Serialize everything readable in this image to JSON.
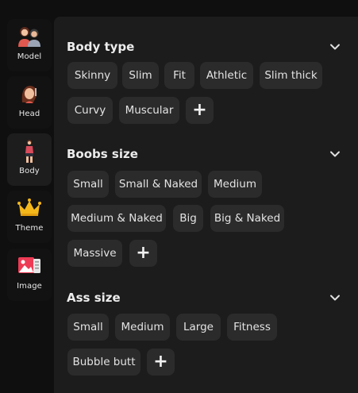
{
  "sidebar": {
    "items": [
      {
        "label": "Model",
        "icon": "model-icon"
      },
      {
        "label": "Head",
        "icon": "head-icon"
      },
      {
        "label": "Body",
        "icon": "body-icon"
      },
      {
        "label": "Theme",
        "icon": "crown-icon"
      },
      {
        "label": "Image",
        "icon": "image-icon"
      }
    ],
    "active": "Body"
  },
  "sections": [
    {
      "title": "Body type",
      "options": [
        "Skinny",
        "Slim",
        "Fit",
        "Athletic",
        "Slim thick",
        "Curvy",
        "Muscular"
      ],
      "add_label": "+"
    },
    {
      "title": "Boobs size",
      "options": [
        "Small",
        "Small & Naked",
        "Medium",
        "Medium & Naked",
        "Big",
        "Big & Naked",
        "Massive"
      ],
      "add_label": "+"
    },
    {
      "title": "Ass size",
      "options": [
        "Small",
        "Medium",
        "Large",
        "Fitness",
        "Bubble butt"
      ],
      "add_label": "+"
    }
  ],
  "colors": {
    "background": "#0f0f0f",
    "panel": "#1c1c1c",
    "chip": "#2b2b2b",
    "text": "#e3e3e3"
  }
}
